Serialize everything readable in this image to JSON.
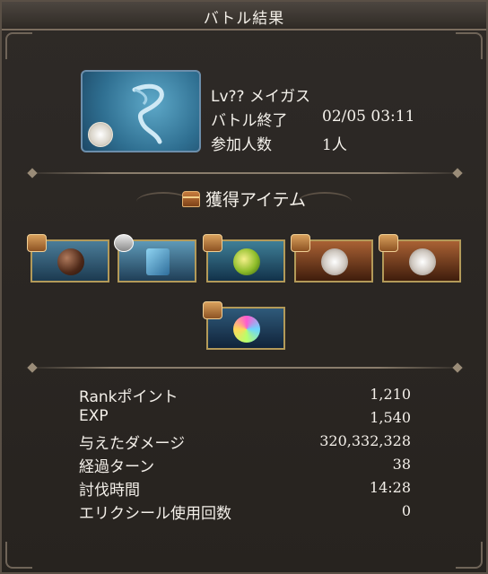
{
  "header": {
    "title": "バトル結果"
  },
  "quest": {
    "name": "Lv?? メイガス",
    "end_label": "バトル終了",
    "end_time": "02/05 03:11",
    "participants_label": "参加人数",
    "participants_value": "1人"
  },
  "rewards": {
    "title": "獲得アイテム",
    "items": [
      {
        "icon": "dark-orb-icon",
        "tag": "treasure-chest-icon"
      },
      {
        "icon": "blue-book-icon",
        "tag": "silver-chest-icon"
      },
      {
        "icon": "wind-orb-icon",
        "tag": "treasure-chest-icon"
      },
      {
        "icon": "silver-coin-icon",
        "tag": "treasure-chest-icon"
      },
      {
        "icon": "silver-coin-icon",
        "tag": "treasure-chest-icon"
      },
      {
        "icon": "prism-orb-icon",
        "tag": "treasure-chest-icon"
      }
    ]
  },
  "stats": [
    {
      "label": "Rankポイント",
      "value": "1,210"
    },
    {
      "label": "EXP",
      "value": "1,540"
    },
    {
      "label": "与えたダメージ",
      "value": "320,332,328"
    },
    {
      "label": "経過ターン",
      "value": "38"
    },
    {
      "label": "討伐時間",
      "value": "14:28"
    },
    {
      "label": "エリクシール使用回数",
      "value": "0"
    }
  ]
}
